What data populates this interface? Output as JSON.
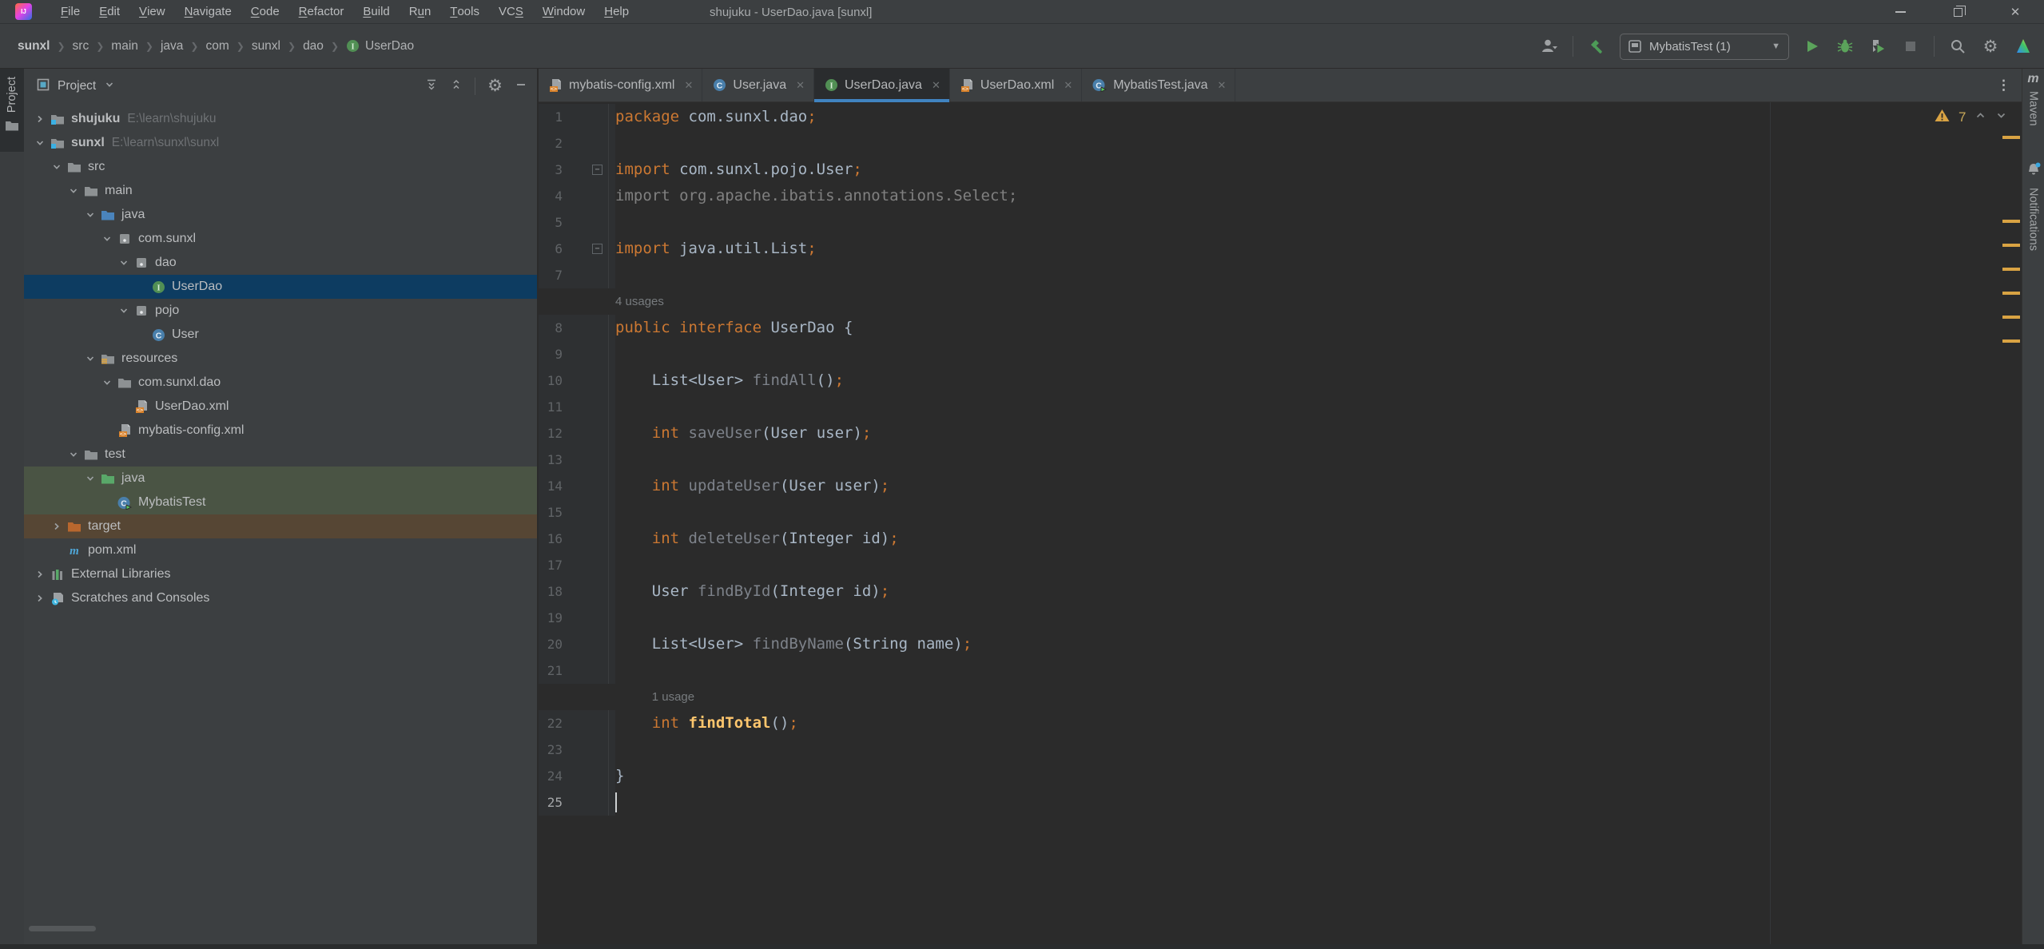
{
  "window": {
    "title": "shujuku - UserDao.java [sunxl]",
    "controls": [
      {
        "name": "minimize"
      },
      {
        "name": "maximize"
      },
      {
        "name": "close"
      }
    ]
  },
  "menu": {
    "items": [
      {
        "label": "File",
        "mnemonic": 0
      },
      {
        "label": "Edit",
        "mnemonic": 0
      },
      {
        "label": "View",
        "mnemonic": 0
      },
      {
        "label": "Navigate",
        "mnemonic": 0
      },
      {
        "label": "Code",
        "mnemonic": 0
      },
      {
        "label": "Refactor",
        "mnemonic": 0
      },
      {
        "label": "Build",
        "mnemonic": 0
      },
      {
        "label": "Run",
        "mnemonic": 1
      },
      {
        "label": "Tools",
        "mnemonic": 0
      },
      {
        "label": "VCS",
        "mnemonic": 2
      },
      {
        "label": "Window",
        "mnemonic": 0
      },
      {
        "label": "Help",
        "mnemonic": 0
      }
    ]
  },
  "breadcrumbs": {
    "items": [
      "sunxl",
      "src",
      "main",
      "java",
      "com",
      "sunxl",
      "dao"
    ],
    "leaf": {
      "label": "UserDao",
      "icon": "interface"
    }
  },
  "toolbar": {
    "run_config": "MybatisTest (1)",
    "controls": [
      {
        "name": "user-dropdown",
        "icon": "user"
      },
      {
        "name": "build-hammer",
        "icon": "hammer",
        "sep_before": true
      },
      {
        "name": "run-config-combo",
        "icon": "app-window",
        "combo": true
      },
      {
        "name": "run-button",
        "icon": "play"
      },
      {
        "name": "debug-button",
        "icon": "bug"
      },
      {
        "name": "coverage-button",
        "icon": "coverage"
      },
      {
        "name": "stop-button",
        "icon": "stop"
      },
      {
        "name": "search-everywhere-button",
        "icon": "search",
        "sep_before": true
      },
      {
        "name": "settings-button",
        "icon": "gear"
      },
      {
        "name": "plugin-button",
        "icon": "colorful-triangle"
      }
    ]
  },
  "tabs": [
    {
      "label": "mybatis-config.xml",
      "icon": "xml-file",
      "active": false
    },
    {
      "label": "User.java",
      "icon": "class",
      "active": false
    },
    {
      "label": "UserDao.java",
      "icon": "interface",
      "active": true
    },
    {
      "label": "UserDao.xml",
      "icon": "xml-file",
      "active": false
    },
    {
      "label": "MybatisTest.java",
      "icon": "test-class",
      "active": false
    }
  ],
  "project_panel": {
    "title": "Project",
    "header_icons": [
      "view-combo",
      "expand-all",
      "collapse-all",
      "gear",
      "hide"
    ],
    "tree": [
      {
        "label": "shujuku",
        "path": "E:\\learn\\shujuku",
        "level": 0,
        "arrow": "right",
        "icon": "project-folder",
        "bold": true
      },
      {
        "label": "sunxl",
        "path": "E:\\learn\\sunxl\\sunxl",
        "level": 0,
        "arrow": "down",
        "icon": "project-folder",
        "bold": true
      },
      {
        "label": "src",
        "level": 1,
        "arrow": "down",
        "icon": "folder"
      },
      {
        "label": "main",
        "level": 2,
        "arrow": "down",
        "icon": "folder"
      },
      {
        "label": "java",
        "level": 3,
        "arrow": "down",
        "icon": "sources-folder"
      },
      {
        "label": "com.sunxl",
        "level": 4,
        "arrow": "down",
        "icon": "package"
      },
      {
        "label": "dao",
        "level": 5,
        "arrow": "down",
        "icon": "package"
      },
      {
        "label": "UserDao",
        "level": 6,
        "arrow": "none",
        "icon": "interface",
        "row": "selected"
      },
      {
        "label": "pojo",
        "level": 5,
        "arrow": "down",
        "icon": "package"
      },
      {
        "label": "User",
        "level": 6,
        "arrow": "none",
        "icon": "class"
      },
      {
        "label": "resources",
        "level": 3,
        "arrow": "down",
        "icon": "resources-folder"
      },
      {
        "label": "com.sunxl.dao",
        "level": 4,
        "arrow": "down",
        "icon": "folder"
      },
      {
        "label": "UserDao.xml",
        "level": 5,
        "arrow": "none",
        "icon": "xml-file"
      },
      {
        "label": "mybatis-config.xml",
        "level": 4,
        "arrow": "none",
        "icon": "xml-file"
      },
      {
        "label": "test",
        "level": 2,
        "arrow": "down",
        "icon": "folder"
      },
      {
        "label": "java",
        "level": 3,
        "arrow": "down",
        "icon": "test-sources-folder",
        "row": "green"
      },
      {
        "label": "MybatisTest",
        "level": 4,
        "arrow": "none",
        "icon": "test-class",
        "row": "green"
      },
      {
        "label": "target",
        "level": 1,
        "arrow": "right",
        "icon": "excluded-folder",
        "row": "brown"
      },
      {
        "label": "pom.xml",
        "level": 1,
        "arrow": "none",
        "icon": "maven"
      },
      {
        "label": "External Libraries",
        "level": 0,
        "arrow": "right",
        "icon": "libraries"
      },
      {
        "label": "Scratches and Consoles",
        "level": 0,
        "arrow": "right",
        "icon": "scratches"
      }
    ]
  },
  "editor": {
    "warning_count": "7",
    "warning_lines": [
      4,
      10,
      12,
      14,
      16,
      18,
      20
    ],
    "lines": [
      {
        "n": "1",
        "segs": [
          [
            "k",
            "package"
          ],
          [
            "p",
            " com.sunxl.dao"
          ],
          [
            "s",
            ";"
          ]
        ]
      },
      {
        "n": "2",
        "segs": []
      },
      {
        "n": "3",
        "fold": true,
        "segs": [
          [
            "k",
            "import"
          ],
          [
            "p",
            " com.sunxl.pojo.User"
          ],
          [
            "s",
            ";"
          ]
        ]
      },
      {
        "n": "4",
        "segs": [
          [
            "g",
            "import org.apache.ibatis.annotations.Select;"
          ]
        ]
      },
      {
        "n": "5",
        "segs": []
      },
      {
        "n": "6",
        "fold": true,
        "segs": [
          [
            "k",
            "import"
          ],
          [
            "p",
            " java.util.List"
          ],
          [
            "s",
            ";"
          ]
        ]
      },
      {
        "n": "7",
        "segs": []
      },
      {
        "hint": "4 usages",
        "indent": 0
      },
      {
        "n": "8",
        "segs": [
          [
            "k",
            "public interface"
          ],
          [
            "p",
            " UserDao {"
          ]
        ]
      },
      {
        "n": "9",
        "segs": []
      },
      {
        "n": "10",
        "segs": [
          [
            "p",
            "    List<User> "
          ],
          [
            "m",
            "findAll"
          ],
          [
            "p",
            "()"
          ],
          [
            "s",
            ";"
          ]
        ]
      },
      {
        "n": "11",
        "segs": []
      },
      {
        "n": "12",
        "segs": [
          [
            "p",
            "    "
          ],
          [
            "k",
            "int"
          ],
          [
            "p",
            " "
          ],
          [
            "m",
            "saveUser"
          ],
          [
            "p",
            "(User user)"
          ],
          [
            "s",
            ";"
          ]
        ]
      },
      {
        "n": "13",
        "segs": []
      },
      {
        "n": "14",
        "segs": [
          [
            "p",
            "    "
          ],
          [
            "k",
            "int"
          ],
          [
            "p",
            " "
          ],
          [
            "m",
            "updateUser"
          ],
          [
            "p",
            "(User user)"
          ],
          [
            "s",
            ";"
          ]
        ]
      },
      {
        "n": "15",
        "segs": []
      },
      {
        "n": "16",
        "segs": [
          [
            "p",
            "    "
          ],
          [
            "k",
            "int"
          ],
          [
            "p",
            " "
          ],
          [
            "m",
            "deleteUser"
          ],
          [
            "p",
            "(Integer id)"
          ],
          [
            "s",
            ";"
          ]
        ]
      },
      {
        "n": "17",
        "segs": []
      },
      {
        "n": "18",
        "segs": [
          [
            "p",
            "    User "
          ],
          [
            "m",
            "findById"
          ],
          [
            "p",
            "(Integer id)"
          ],
          [
            "s",
            ";"
          ]
        ]
      },
      {
        "n": "19",
        "segs": []
      },
      {
        "n": "20",
        "segs": [
          [
            "p",
            "    List<User> "
          ],
          [
            "m",
            "findByName"
          ],
          [
            "p",
            "(String name)"
          ],
          [
            "s",
            ";"
          ]
        ]
      },
      {
        "n": "21",
        "segs": []
      },
      {
        "hint": "1 usage",
        "indent": 4
      },
      {
        "n": "22",
        "segs": [
          [
            "p",
            "    "
          ],
          [
            "k",
            "int"
          ],
          [
            "p",
            " "
          ],
          [
            "f",
            "findTotal"
          ],
          [
            "p",
            "()"
          ],
          [
            "s",
            ";"
          ]
        ]
      },
      {
        "n": "23",
        "segs": []
      },
      {
        "n": "24",
        "segs": [
          [
            "p",
            "}"
          ]
        ]
      },
      {
        "n": "25",
        "cursor": true,
        "segs": []
      }
    ]
  },
  "right_bar": {
    "maven_label": "Maven",
    "notifications_label": "Notifications"
  },
  "left_bar": {
    "project_label": "Project"
  },
  "tab_overflow": "⋮",
  "colors": {
    "accent_blue": "#4083c0",
    "selection_blue": "#0d3c61",
    "warning_yellow": "#d9a343",
    "keyword_orange": "#CC7832",
    "used_method_yellow": "#FFC66D",
    "run_green": "#5ba35b"
  }
}
